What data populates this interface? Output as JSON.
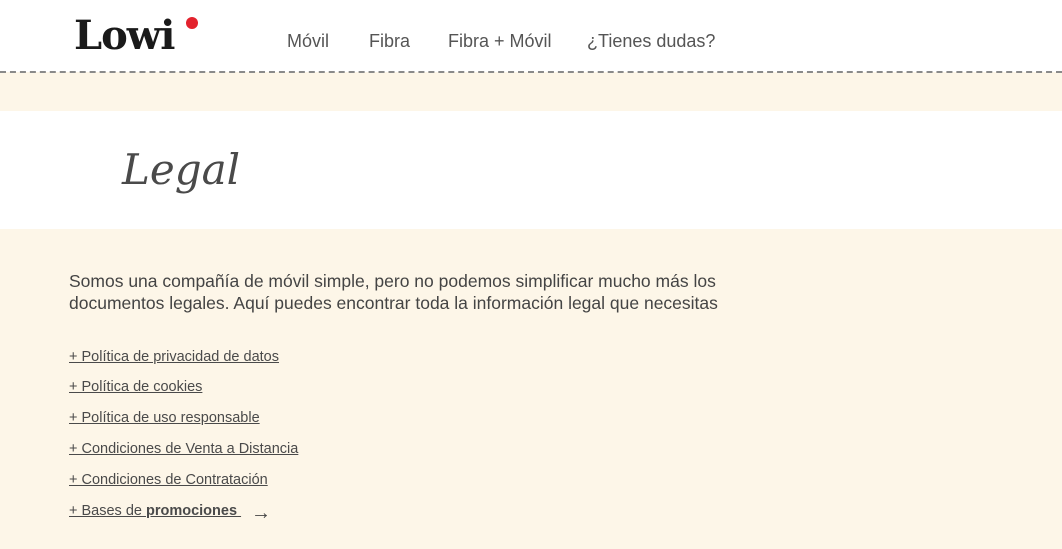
{
  "header": {
    "logo_text": "Lowi",
    "nav": [
      "Móvil",
      "Fibra",
      "Fibra + Móvil",
      "¿Tienes dudas?"
    ]
  },
  "hero": {
    "title": "Legal"
  },
  "intro": {
    "line1": "Somos una compañía de móvil simple, pero no podemos simplificar mucho más los",
    "line2": "documentos legales. Aquí puedes encontrar toda la información legal que necesitas"
  },
  "links": [
    "+ Política de privacidad de datos",
    "+ Política de cookies",
    "+ Política de uso responsable",
    "+ Condiciones de Venta a Distancia",
    "+ Condiciones de Contratación"
  ],
  "promo_link": {
    "prefix": "+ Bases de ",
    "bold": "promociones",
    "arrow": "→"
  },
  "colors": {
    "brand_red": "#e3222d",
    "background": "#fdf6e8"
  }
}
